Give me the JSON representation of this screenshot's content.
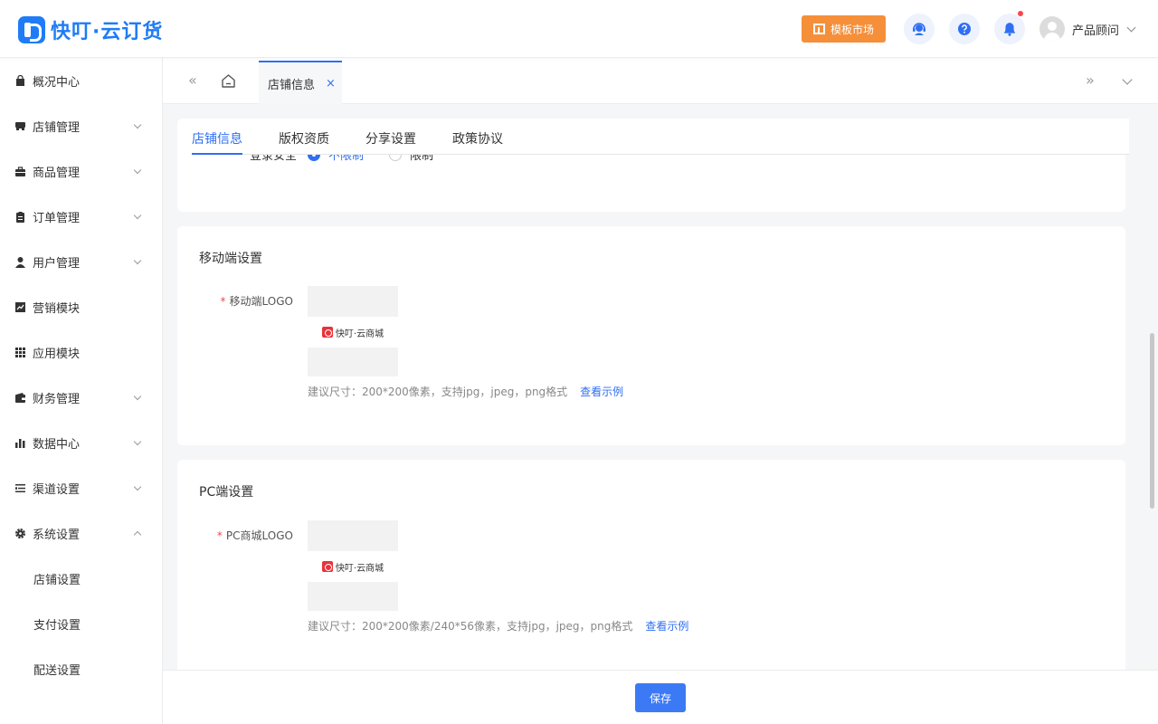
{
  "app": {
    "logo_text": "快叮·云订货"
  },
  "header": {
    "template_market_label": "模板市场",
    "user_name": "产品顾问",
    "colors": {
      "brand": "#1f7cf6",
      "template_button": "#f58f3a",
      "notification_dot": "#f5474d"
    },
    "icons": [
      "support-agent-icon",
      "help-icon",
      "bell-icon",
      "user-avatar-icon",
      "chevron-down-icon"
    ]
  },
  "sidebar": {
    "items": [
      {
        "label": "概况中心",
        "icon": "bag-icon",
        "expandable": false
      },
      {
        "label": "店铺管理",
        "icon": "store-icon",
        "expandable": true
      },
      {
        "label": "商品管理",
        "icon": "briefcase-icon",
        "expandable": true
      },
      {
        "label": "订单管理",
        "icon": "clipboard-icon",
        "expandable": true
      },
      {
        "label": "用户管理",
        "icon": "user-icon",
        "expandable": true
      },
      {
        "label": "营销模块",
        "icon": "trend-chart-icon",
        "expandable": false
      },
      {
        "label": "应用模块",
        "icon": "grid-icon",
        "expandable": false
      },
      {
        "label": "财务管理",
        "icon": "wallet-icon",
        "expandable": true
      },
      {
        "label": "数据中心",
        "icon": "bar-chart-icon",
        "expandable": true
      },
      {
        "label": "渠道设置",
        "icon": "list-settings-icon",
        "expandable": true
      },
      {
        "label": "系统设置",
        "icon": "gear-icon",
        "expandable": true,
        "expanded": true
      }
    ],
    "sub_items": [
      {
        "label": "店铺设置"
      },
      {
        "label": "支付设置"
      },
      {
        "label": "配送设置"
      }
    ]
  },
  "tabbar": {
    "prev_glyph": "«",
    "next_glyph": "»",
    "active_tab_label": "店铺信息",
    "close_glyph": "×"
  },
  "subtabs": [
    {
      "label": "店铺信息",
      "active": true
    },
    {
      "label": "版权资质",
      "active": false
    },
    {
      "label": "分享设置",
      "active": false
    },
    {
      "label": "政策协议",
      "active": false
    }
  ],
  "login_security": {
    "label": "登录安全",
    "options": [
      {
        "label": "不限制",
        "selected": true
      },
      {
        "label": "限制",
        "selected": false
      }
    ]
  },
  "mobile_settings": {
    "title": "移动端设置",
    "logo_label": "移动端LOGO",
    "required_mark": "*",
    "logo_text": "快叮·云商城",
    "hint": "建议尺寸：200*200像素，支持jpg，jpeg，png格式",
    "example_link": "查看示例"
  },
  "pc_settings": {
    "title": "PC端设置",
    "logo_label": "PC商城LOGO",
    "required_mark": "*",
    "logo_text": "快叮·云商城",
    "hint": "建议尺寸：200*200像素/240*56像素，支持jpg，jpeg，png格式",
    "example_link": "查看示例"
  },
  "footer": {
    "save_label": "保存",
    "save_color": "#3c7af5"
  }
}
